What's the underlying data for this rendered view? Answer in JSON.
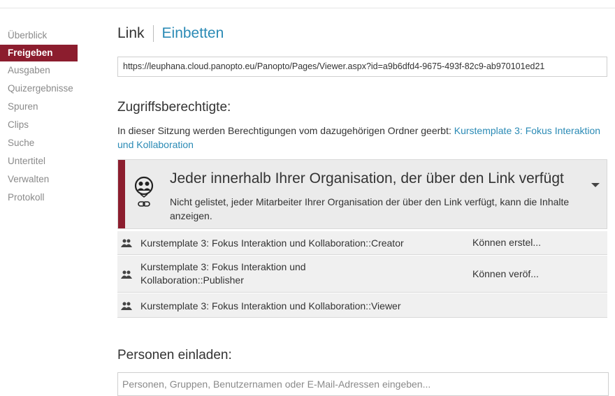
{
  "sidebar": {
    "items": [
      {
        "label": "Überblick",
        "active": false
      },
      {
        "label": "Freigeben",
        "active": true
      },
      {
        "label": "Ausgaben",
        "active": false
      },
      {
        "label": "Quizergebnisse",
        "active": false
      },
      {
        "label": "Spuren",
        "active": false
      },
      {
        "label": "Clips",
        "active": false
      },
      {
        "label": "Suche",
        "active": false
      },
      {
        "label": "Untertitel",
        "active": false
      },
      {
        "label": "Verwalten",
        "active": false
      },
      {
        "label": "Protokoll",
        "active": false
      }
    ]
  },
  "tabs": {
    "link": "Link",
    "embed": "Einbetten"
  },
  "share_url": "https://leuphana.cloud.panopto.eu/Panopto/Pages/Viewer.aspx?id=a9b6dfd4-9675-493f-82c9-ab970101ed21",
  "access": {
    "heading": "Zugriffsberechtigte:",
    "inherit_text": "In dieser Sitzung werden Berechtigungen vom dazugehörigen Ordner geerbt: ",
    "folder_link": "Kurstemplate 3: Fokus Interaktion und Kollaboration",
    "org": {
      "title": "Jeder innerhalb Ihrer Organisation, der über den Link verfügt",
      "description": "Nicht gelistet, jeder Mitarbeiter Ihrer Organisation der über den Link verfügt, kann die Inhalte anzeigen.",
      "icon": "group-link-icon"
    },
    "groups": [
      {
        "name": "Kurstemplate 3: Fokus Interaktion und Kollaboration::Creator",
        "role": "Können erstel..."
      },
      {
        "name": "Kurstemplate 3: Fokus Interaktion und Kollaboration::Publisher",
        "role": "Können veröf..."
      },
      {
        "name": "Kurstemplate 3: Fokus Interaktion und Kollaboration::Viewer",
        "role": ""
      }
    ]
  },
  "invite": {
    "heading": "Personen einladen:",
    "placeholder": "Personen, Gruppen, Benutzernamen oder E-Mail-Adressen eingeben..."
  },
  "colors": {
    "accent": "#8c1d2e",
    "link": "#2a8ab5"
  }
}
